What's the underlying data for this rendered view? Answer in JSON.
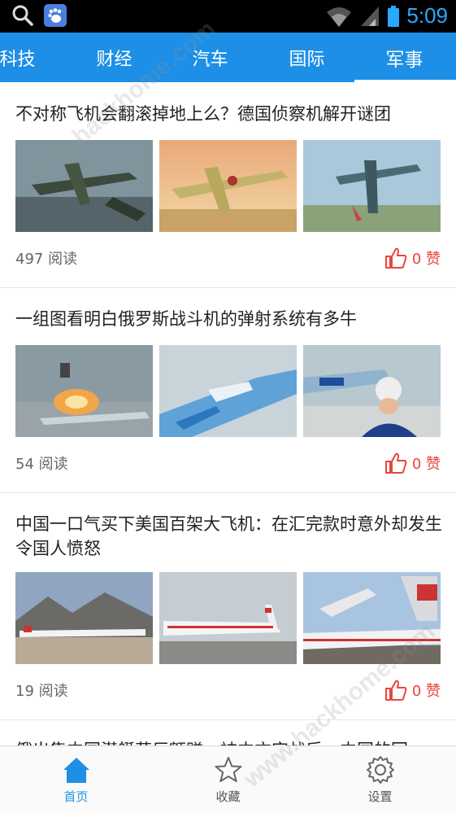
{
  "status_bar": {
    "time": "5:09",
    "icons": [
      "search-icon",
      "baidu-app-icon",
      "wifi-icon",
      "signal-icon",
      "battery-icon"
    ]
  },
  "tabs": [
    {
      "label": "科技",
      "active": false
    },
    {
      "label": "财经",
      "active": false
    },
    {
      "label": "汽车",
      "active": false
    },
    {
      "label": "国际",
      "active": false
    },
    {
      "label": "军事",
      "active": true
    }
  ],
  "articles": [
    {
      "title": "不对称飞机会翻滚掉地上么？德国侦察机解开谜团",
      "reads": "497 阅读",
      "likes": "0 赞"
    },
    {
      "title": "一组图看明白俄罗斯战斗机的弹射系统有多牛",
      "reads": "54 阅读",
      "likes": "0 赞"
    },
    {
      "title": "中国一口气买下美国百架大飞机：在汇完款时意外却发生令国人愤怒",
      "reads": "19 阅读",
      "likes": "0 赞"
    },
    {
      "title": "俄出售中国潜艇获巨额赚，被中方实战后，中国的回"
    }
  ],
  "bottom_nav": [
    {
      "label": "首页",
      "icon": "home-icon",
      "active": true
    },
    {
      "label": "收藏",
      "icon": "star-icon",
      "active": false
    },
    {
      "label": "设置",
      "icon": "gear-icon",
      "active": false
    }
  ],
  "watermark": "www.hackhome.com",
  "colors": {
    "accent": "#1e8fe6",
    "like": "#e8453c",
    "time": "#2aa8ff"
  }
}
